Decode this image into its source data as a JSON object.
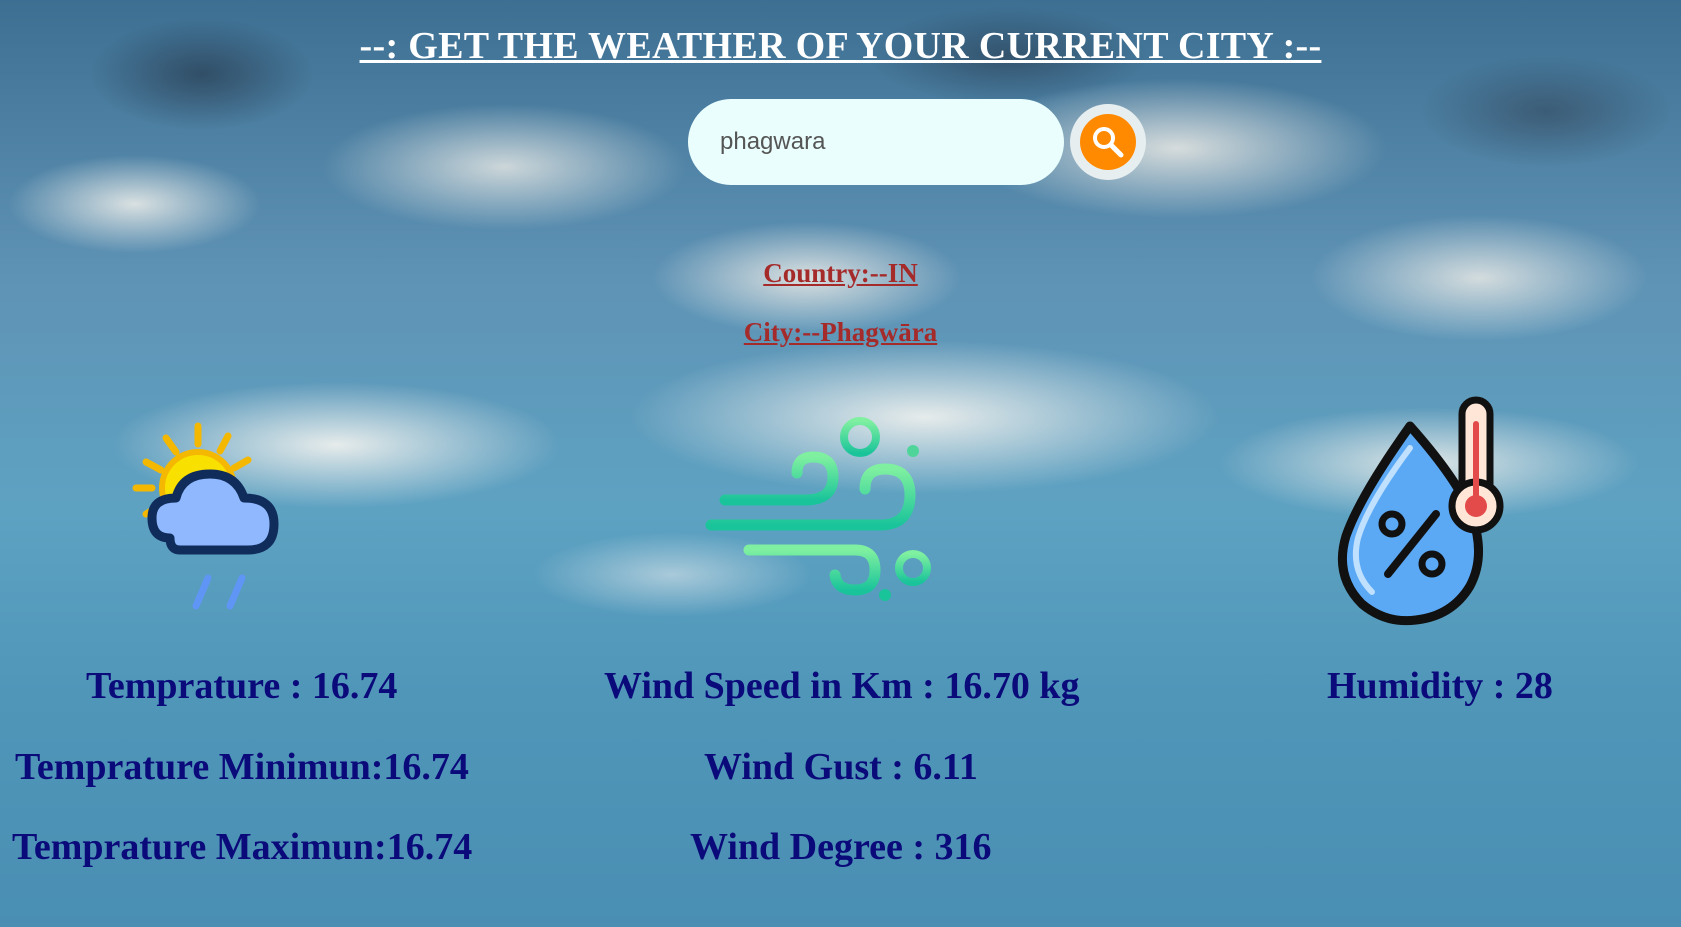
{
  "header": {
    "title": "--: GET THE WEATHER OF YOUR CURRENT CITY :--"
  },
  "search": {
    "value": "phagwara",
    "button_icon": "search-icon",
    "button_color": "#ff8a00"
  },
  "location": {
    "country": "Country:--IN",
    "city": "City:--Phagwāra",
    "color": "#a52a2a"
  },
  "icons": {
    "weather": "sun-cloud-rain-icon",
    "wind": "wind-icon",
    "humidity": "humidity-thermometer-icon"
  },
  "stats": {
    "temperature": "Temprature : 16.74",
    "temperature_min": "Temprature Minimun:16.74",
    "temperature_max": "Temprature Maximun:16.74",
    "wind_speed": "Wind Speed in Km : 16.70 kg",
    "wind_gust": "Wind Gust : 6.11",
    "wind_degree": "Wind Degree : 316",
    "humidity": "Humidity : 28",
    "color": "#0a0a7a"
  }
}
